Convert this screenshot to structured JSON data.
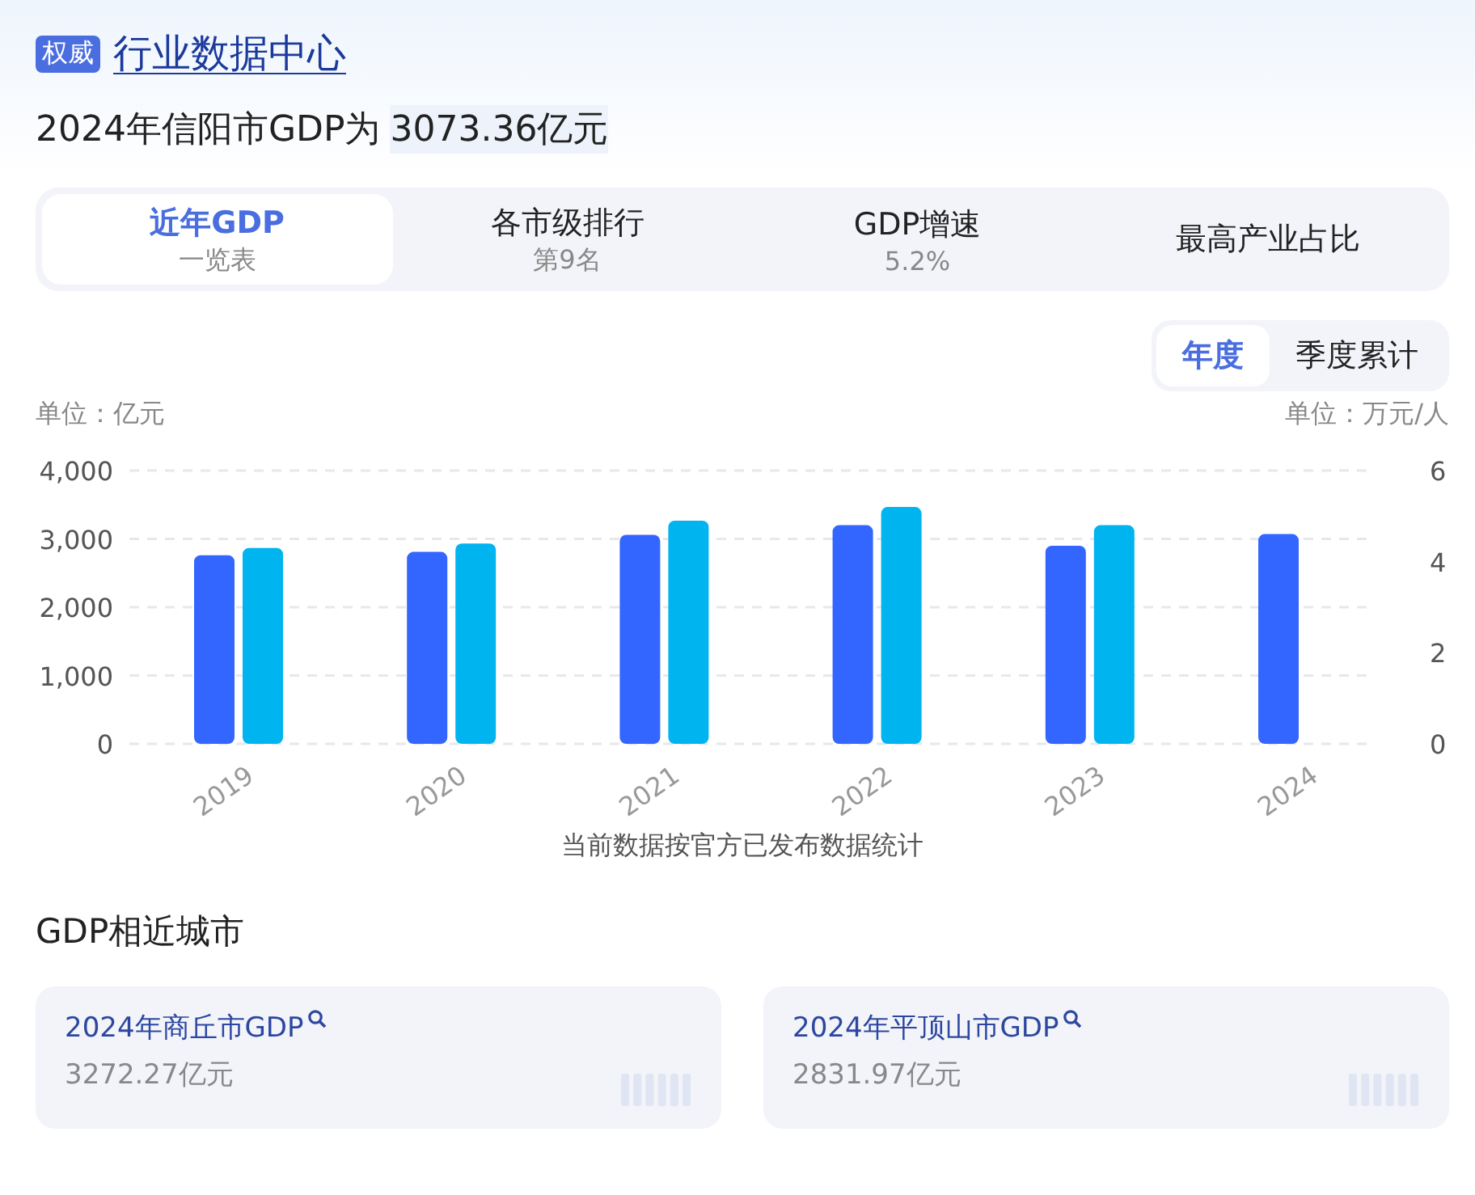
{
  "header": {
    "badge": "权威",
    "title": "行业数据中心"
  },
  "headline": {
    "text": "2024年信阳市GDP为",
    "value": "3073.36亿元"
  },
  "tabs": [
    {
      "label": "近年GDP",
      "sub": "一览表",
      "selected": true
    },
    {
      "label": "各市级排行",
      "sub": "第9名",
      "selected": false
    },
    {
      "label": "GDP增速",
      "sub": "5.2%",
      "selected": false
    },
    {
      "label": "最高产业占比",
      "selected": false
    }
  ],
  "period_toggle": [
    {
      "label": "年度",
      "selected": true
    },
    {
      "label": "季度累计",
      "selected": false
    }
  ],
  "unit_left": "单位：亿元",
  "unit_right": "单位：万元/人",
  "chart_data": {
    "type": "bar",
    "categories": [
      "2019",
      "2020",
      "2021",
      "2022",
      "2023",
      "2024"
    ],
    "series": [
      {
        "color": "#3366ff",
        "values": [
          2760,
          2810,
          3060,
          3200,
          2900,
          3070
        ]
      },
      {
        "color": "#00b4f0",
        "axis": "y2",
        "values": [
          4.3,
          4.4,
          4.9,
          5.2,
          4.8,
          null
        ]
      }
    ],
    "ylim": [
      0,
      4000
    ],
    "yticks": [
      0,
      {
        "value": 1000,
        "label": "1,000"
      },
      {
        "value": 2000,
        "label": "2,000"
      },
      {
        "value": 3000,
        "label": "3,000"
      },
      {
        "value": 4000,
        "label": "4,000"
      }
    ],
    "grid": true,
    "y2lim": [
      0,
      6
    ],
    "y2ticks": [
      0,
      2,
      4,
      6
    ]
  },
  "chart_note": "当前数据按官方已发布数据统计",
  "similar": {
    "title": "GDP相近城市",
    "cities": [
      {
        "name": "2024年商丘市GDP",
        "value": "3272.27亿元"
      },
      {
        "name": "2024年平顶山市GDP",
        "value": "2831.97亿元"
      }
    ]
  }
}
